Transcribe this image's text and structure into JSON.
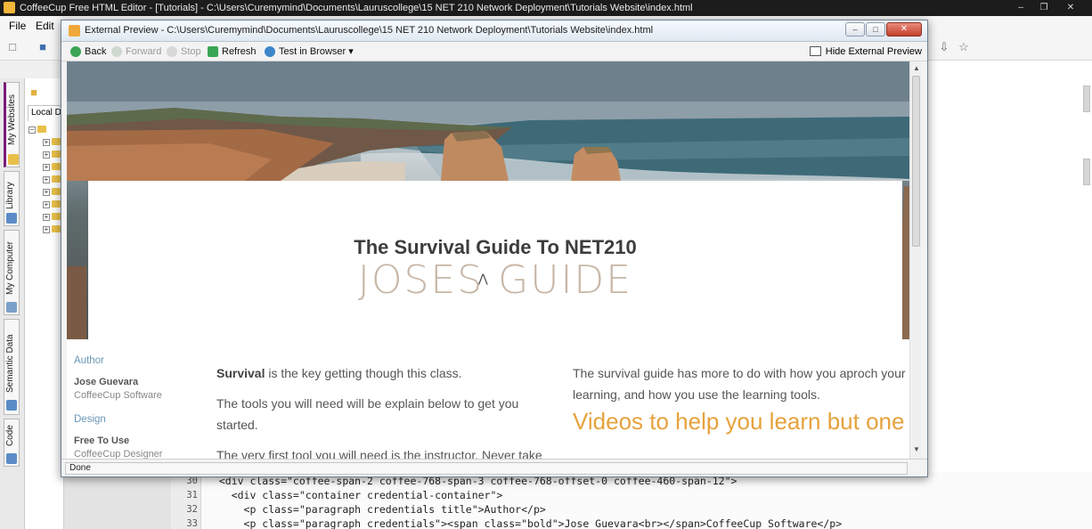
{
  "app": {
    "title": "CoffeeCup Free HTML Editor - [Tutorials] - C:\\Users\\Curemymind\\Documents\\Lauruscollege\\15 NET 210 Network Deployment\\Tutorials Website\\index.html",
    "menus": [
      "File",
      "Edit"
    ]
  },
  "side_tabs": [
    "My Websites",
    "Library",
    "My Computer",
    "Semantic Data",
    "Code"
  ],
  "file_panel": {
    "tab_label": "Local Di"
  },
  "code": {
    "lines": [
      {
        "num": "30",
        "text": "  <div class=\"coffee-span-2 coffee-768-span-3 coffee-768-offset-0 coffee-460-span-12\">"
      },
      {
        "num": "31",
        "text": "    <div class=\"container credential-container\">"
      },
      {
        "num": "32",
        "text": "      <p class=\"paragraph credentials title\">Author</p>"
      },
      {
        "num": "33",
        "text": "      <p class=\"paragraph credentials\"><span class=\"bold\">Jose Guevara<br></span>CoffeeCup Software</p>"
      }
    ]
  },
  "preview": {
    "title": "External Preview - C:\\Users\\Curemymind\\Documents\\Lauruscollege\\15 NET 210 Network Deployment\\Tutorials Website\\index.html",
    "toolbar": {
      "back": "Back",
      "forward": "Forward",
      "stop": "Stop",
      "refresh": "Refresh",
      "test_in_browser": "Test in Browser",
      "hide_external_preview": "Hide External Preview"
    },
    "status": "Done"
  },
  "site": {
    "heading": "The Survival Guide To NET210",
    "title": "JOSES GUIDE",
    "credentials": {
      "author_title": "Author",
      "author_name": "Jose Guevara",
      "author_company": "CoffeeCup Software",
      "design_title": "Design",
      "design_name": "Free To Use",
      "design_company": "CoffeeCup Designer"
    },
    "paragraph1_bold": "Survival",
    "paragraph1_rest": " is the key getting though this class.",
    "paragraph2": "The tools you will need will be explain below to get you started.",
    "paragraph3": "The very first tool you will need is the instructor. Never take",
    "right_paragraph": "The survival guide has more to do with how you aproch your learning, and how you use the learning tools.",
    "videos_heading": "Videos to help you learn but one must becareful"
  },
  "colors": {
    "accent_orange": "#e6a23c",
    "title_tan": "#c7b6a6",
    "credential_blue": "#6a98b8"
  }
}
